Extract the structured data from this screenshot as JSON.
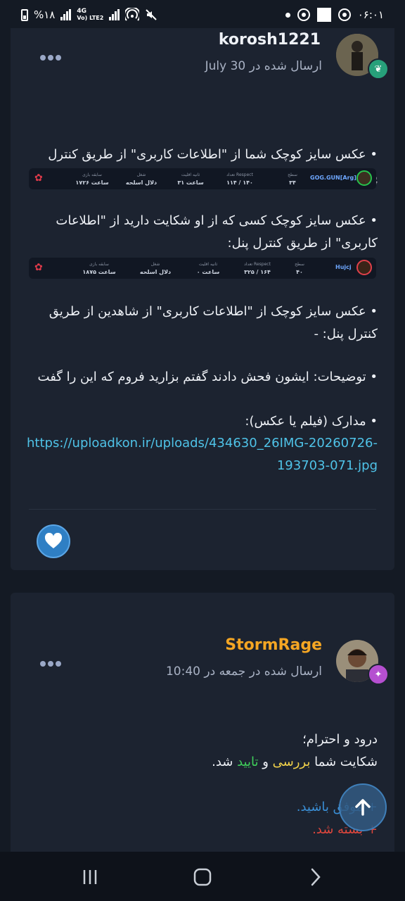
{
  "status_bar": {
    "battery": "%۱۸",
    "network": "4G",
    "network_sub": "Vo) LTE2",
    "time": "۰۶:۰۱"
  },
  "post1": {
    "username": "korosh1221",
    "posted": "ارسال شده در 30 July",
    "line1": "• عکس سایز کوچک شما از \"اطلاعات کاربری\" از طریق کنترل پنل:",
    "strip1": {
      "name": "GOG.GUN[Arg]",
      "cells": [
        {
          "k": "سطح",
          "v": "۳۴"
        },
        {
          "k": "تعداد Respect",
          "v": "۱۱۴ / ۱۴۰"
        },
        {
          "k": "ثانیه اقلیت",
          "v": "۳۱ ساعت"
        },
        {
          "k": "شغل",
          "v": "دلال اسلحه"
        },
        {
          "k": "سابقه بازی",
          "v": "۱۷۲۶ ساعت"
        }
      ]
    },
    "line2": "• عکس سایز کوچک کسی که از او شکایت دارید از \"اطلاعات کاربری\" از طریق کنترل پنل:",
    "strip2": {
      "name": "Hujcj",
      "cells": [
        {
          "k": "سطح",
          "v": "۴۰"
        },
        {
          "k": "تعداد Respect",
          "v": "۳۲۵ / ۱۶۴"
        },
        {
          "k": "ثانیه اقلیت",
          "v": "۰ ساعت"
        },
        {
          "k": "شغل",
          "v": "دلال اسلحه"
        },
        {
          "k": "سابقه بازی",
          "v": "۱۸۷۵ ساعت"
        }
      ]
    },
    "line3": "• عکس سایز کوچک از \"اطلاعات کاربری\" از شاهدین از طریق کنترل پنل: -",
    "line4": "• توضیحات: ایشون فحش دادند گفتم بزارید فروم که این را گفت",
    "line5": "• مدارک (فیلم یا عکس):",
    "link": "https://uploadkon.ir/uploads/434630_26IMG-20260726-193703-071.jpg"
  },
  "post2": {
    "username": "StormRage",
    "posted": "ارسال شده در جمعه در 10:40",
    "greeting": "درود و احترام؛",
    "msg_a": "شکایت شما",
    "msg_reviewed": "بررسی",
    "msg_and": "و",
    "msg_approved": "تایید",
    "msg_end": "شد.",
    "success": "+ موفق باشید.",
    "closed": "+ بسته شد."
  },
  "colors": {
    "username2": "#f5a623",
    "reviewed": "#f3d34a",
    "approved": "#3fcf5a",
    "success": "#3a8fd6",
    "closed": "#e0473d",
    "link": "#4fc3e8"
  }
}
